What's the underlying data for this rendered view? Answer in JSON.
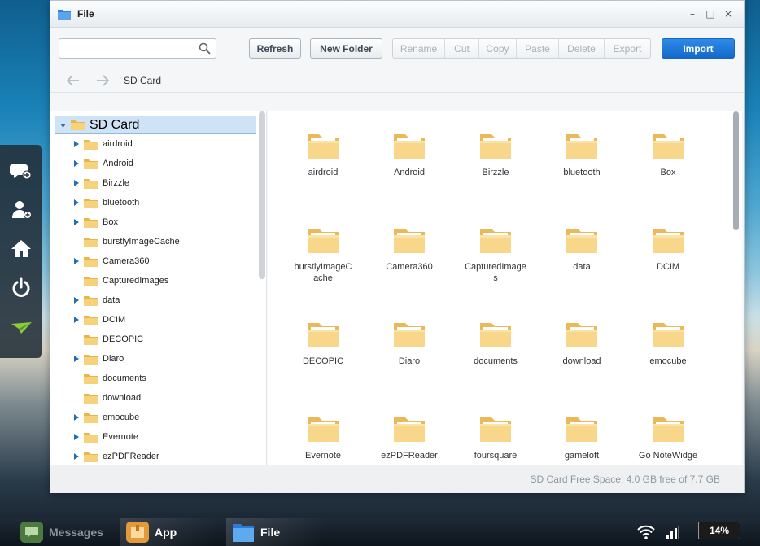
{
  "window": {
    "title": "File",
    "controls": [
      "–",
      "□",
      "×"
    ]
  },
  "toolbar": {
    "search_placeholder": "",
    "refresh_label": "Refresh",
    "new_folder_label": "New Folder",
    "rename_label": "Rename",
    "cut_label": "Cut",
    "copy_label": "Copy",
    "paste_label": "Paste",
    "delete_label": "Delete",
    "export_label": "Export",
    "import_label": "Import"
  },
  "path": {
    "current": "SD Card"
  },
  "tree": {
    "root": "SD Card",
    "items": [
      {
        "label": "airdroid",
        "expandable": true
      },
      {
        "label": "Android",
        "expandable": true
      },
      {
        "label": "Birzzle",
        "expandable": true
      },
      {
        "label": "bluetooth",
        "expandable": true
      },
      {
        "label": "Box",
        "expandable": true
      },
      {
        "label": "burstlyImageCache",
        "expandable": false
      },
      {
        "label": "Camera360",
        "expandable": true
      },
      {
        "label": "CapturedImages",
        "expandable": false
      },
      {
        "label": "data",
        "expandable": true
      },
      {
        "label": "DCIM",
        "expandable": true
      },
      {
        "label": "DECOPIC",
        "expandable": false
      },
      {
        "label": "Diaro",
        "expandable": true
      },
      {
        "label": "documents",
        "expandable": false
      },
      {
        "label": "download",
        "expandable": false
      },
      {
        "label": "emocube",
        "expandable": true
      },
      {
        "label": "Evernote",
        "expandable": true
      },
      {
        "label": "ezPDFReader",
        "expandable": true
      }
    ]
  },
  "grid": {
    "folders": [
      "airdroid",
      "Android",
      "Birzzle",
      "bluetooth",
      "Box",
      "burstlyImageCache",
      "Camera360",
      "CapturedImages",
      "data",
      "DCIM",
      "DECOPIC",
      "Diaro",
      "documents",
      "download",
      "emocube",
      "Evernote",
      "ezPDFReader",
      "foursquare",
      "gameloft",
      "Go NoteWidge"
    ]
  },
  "status": {
    "free_space": "SD Card Free Space: 4.0 GB free of 7.7 GB"
  },
  "taskbar": {
    "messages_label": "Messages",
    "app_label": "App",
    "file_label": "File",
    "battery": "14%"
  },
  "colors": {
    "accent": "#1a6fd4",
    "folder": "#f5c96a",
    "selected": "#cfe3f6"
  }
}
